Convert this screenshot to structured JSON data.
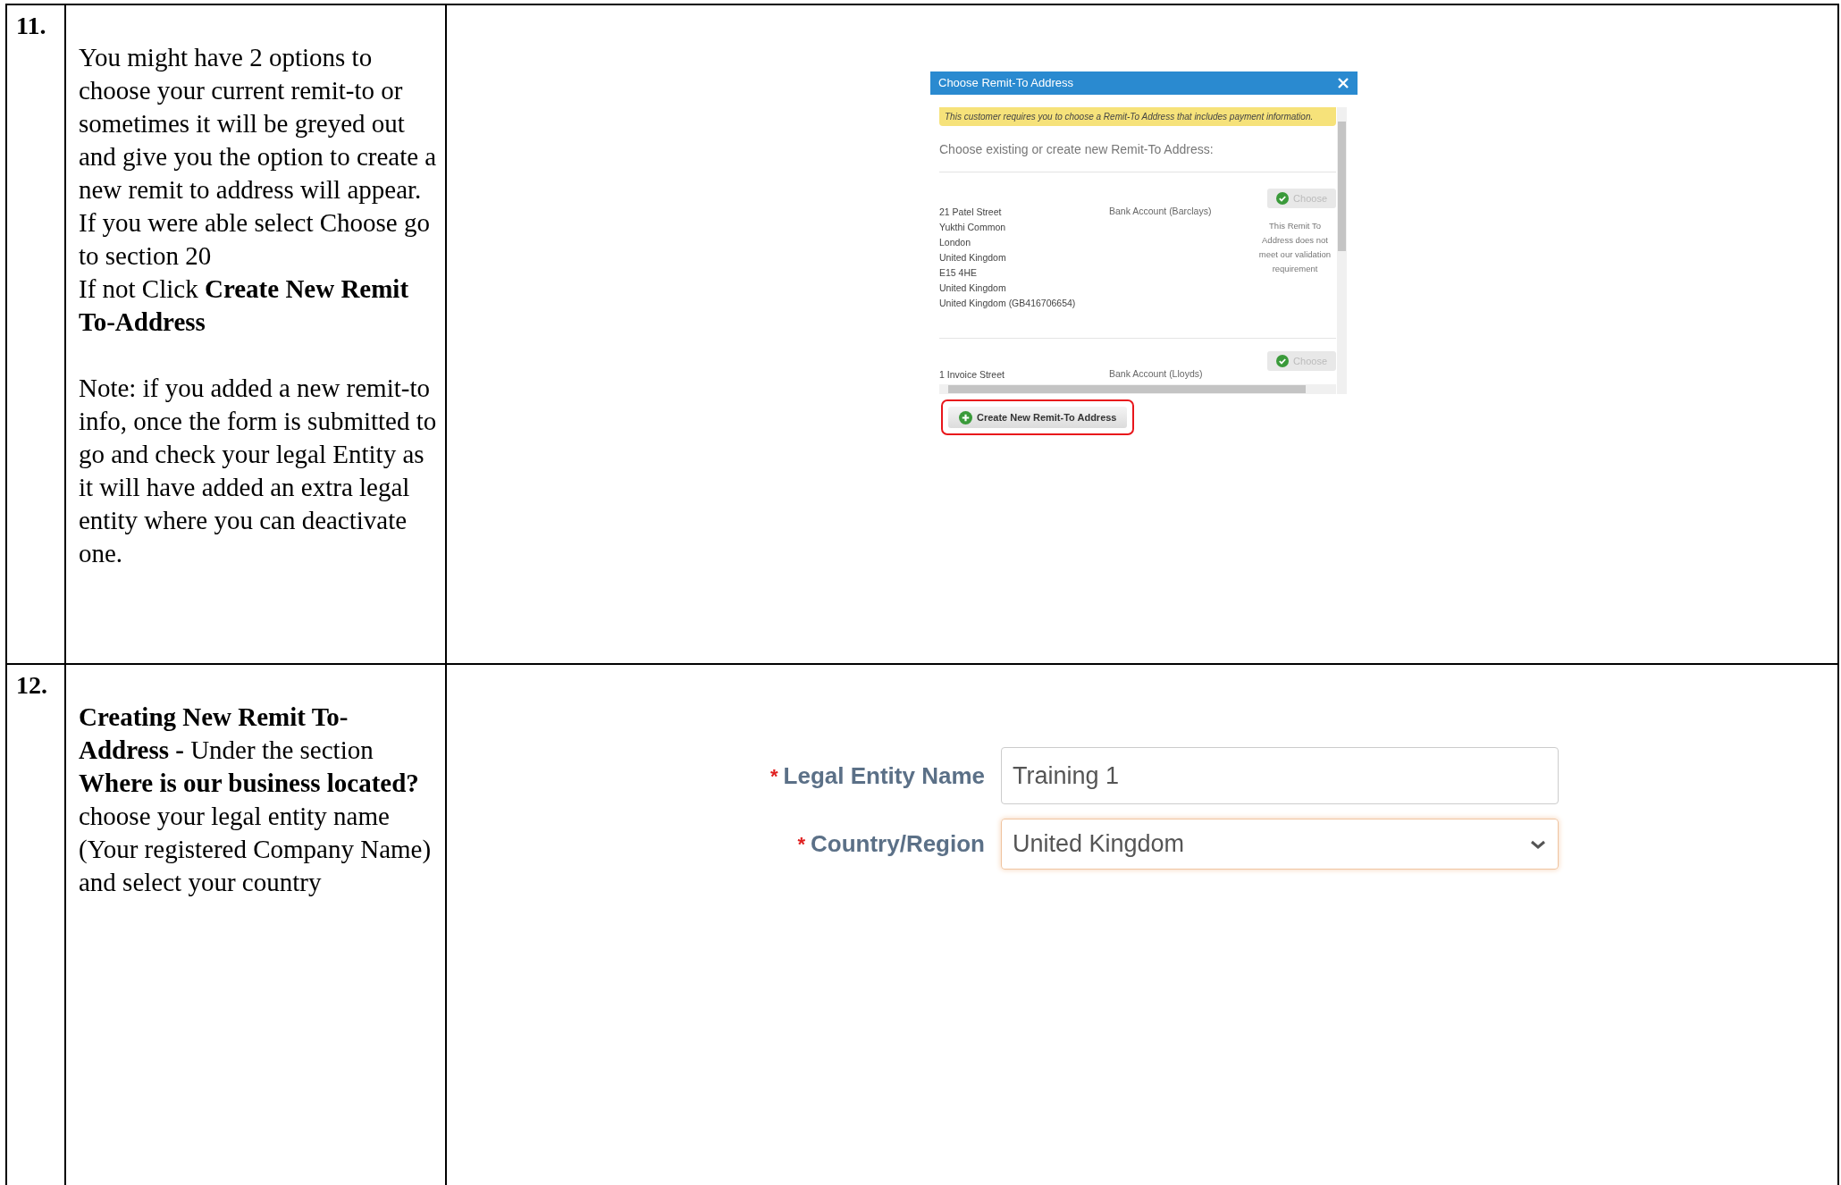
{
  "rows": [
    {
      "number": "11.",
      "blocks": [
        [
          "You might have 2 options to choose your current remit-to or sometimes it will be greyed out and give you the option to create a new remit to address will appear.",
          "If you were able select Choose go to section 20",
          "If not Click **Create New Remit To-Address**"
        ],
        [
          "Note: if you added a new remit-to info, once the form is submitted to go and check your legal Entity as it will have added an extra legal entity where you can deactivate one."
        ]
      ],
      "screenshot": {
        "kind": "dialog",
        "title": "Choose Remit-To Address",
        "notice": "This customer requires you to choose a Remit-To Address that includes payment information.",
        "heading": "Choose existing or create new Remit-To Address:",
        "addresses": [
          {
            "lines": [
              "21 Patel Street",
              "Yukthi Common",
              "London",
              "United Kingdom",
              "E15 4HE",
              "United Kingdom",
              "United Kingdom (GB416706654)"
            ],
            "bank": "Bank Account (Barclays)",
            "choose": "Choose",
            "disabled": true,
            "warning": "This Remit To Address does not meet our validation requirement"
          },
          {
            "lines": [
              "1 Invoice Street"
            ],
            "bank": "Bank Account (Lloyds)",
            "choose": "Choose",
            "disabled": true
          }
        ],
        "create_button": {
          "label": "Create New Remit-To Address",
          "highlighted": true
        }
      }
    },
    {
      "number": "12.",
      "blocks": [
        [
          "**Creating New Remit To-Address -** Under the section **Where is our business located?** choose your legal entity name (Your registered Company Name) and select your country"
        ]
      ],
      "screenshot": {
        "kind": "form",
        "fields": [
          {
            "label": "Legal Entity Name",
            "required_mark": "*",
            "kind": "text",
            "value": "Training 1",
            "focused": false
          },
          {
            "label": "Country/Region",
            "required_mark": "*",
            "kind": "select",
            "value": "United Kingdom",
            "focused": true
          }
        ]
      }
    }
  ]
}
